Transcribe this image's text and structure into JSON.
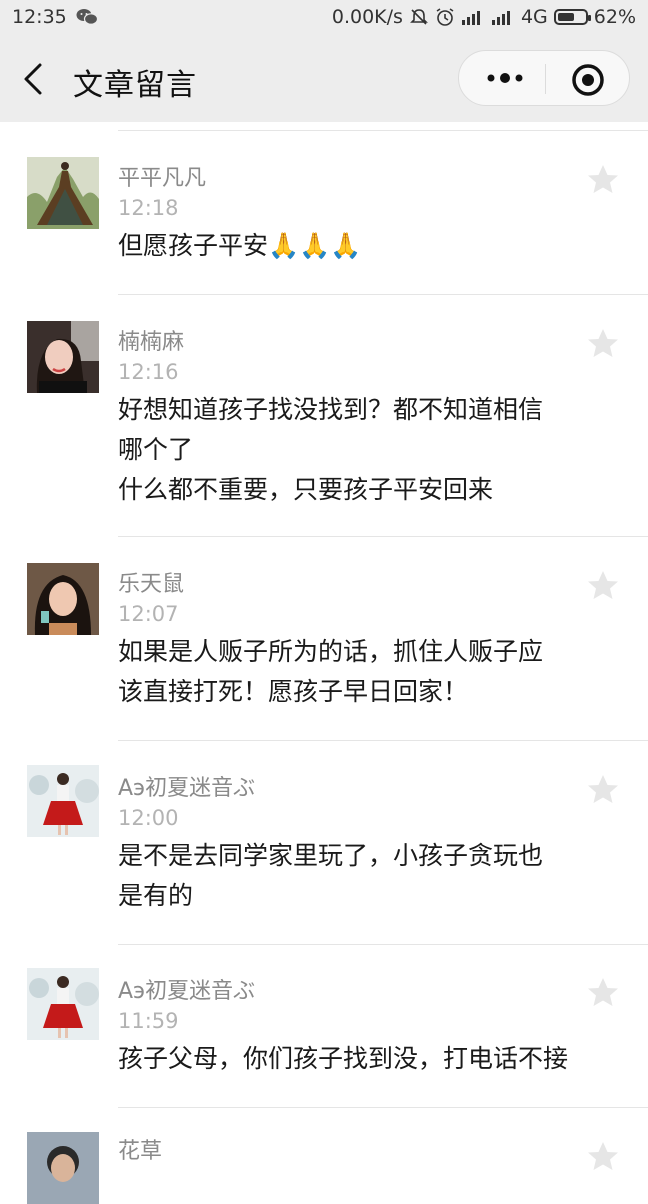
{
  "status": {
    "time": "12:35",
    "speed": "0.00K/s",
    "network": "4G",
    "battery": "62%",
    "battery_level": 0.62,
    "icons": [
      "wechat-icon",
      "mute-icon",
      "alarm-icon",
      "signal-icon",
      "signal-icon",
      "battery-icon"
    ]
  },
  "header": {
    "title": "文章留言",
    "icons": [
      "back-icon",
      "more-icon",
      "target-icon"
    ]
  },
  "comments": [
    {
      "name": "平平凡凡",
      "time": "12:18",
      "lines": [
        "但愿孩子平安🙏🙏🙏"
      ],
      "avatar": "woman-in-gown-avatar"
    },
    {
      "name": "楠楠麻",
      "time": "12:16",
      "lines": [
        "好想知道孩子找没找到？都不知道相信",
        "哪个了",
        "什么都不重要，只要孩子平安回来"
      ],
      "avatar": "woman-selfie-avatar"
    },
    {
      "name": "乐天鼠",
      "time": "12:07",
      "lines": [
        "如果是人贩子所为的话，抓住人贩子应",
        "该直接打死！愿孩子早日回家！"
      ],
      "avatar": "woman-portrait-avatar"
    },
    {
      "name": "Aэ初夏迷音ぶ",
      "time": "12:00",
      "lines": [
        "是不是去同学家里玩了，小孩子贪玩也",
        "是有的"
      ],
      "avatar": "girl-red-skirt-avatar"
    },
    {
      "name": "Aэ初夏迷音ぶ",
      "time": "11:59",
      "lines": [
        "孩子父母，你们孩子找到没，打电话不接"
      ],
      "avatar": "girl-red-skirt-avatar"
    },
    {
      "name": "花草",
      "time": "",
      "lines": [],
      "avatar": "person-avatar"
    }
  ],
  "colors": {
    "bar_bg": "#ededed",
    "name": "#8a8a8a",
    "time": "#b3b3b3",
    "star": "#e6e6e6"
  }
}
